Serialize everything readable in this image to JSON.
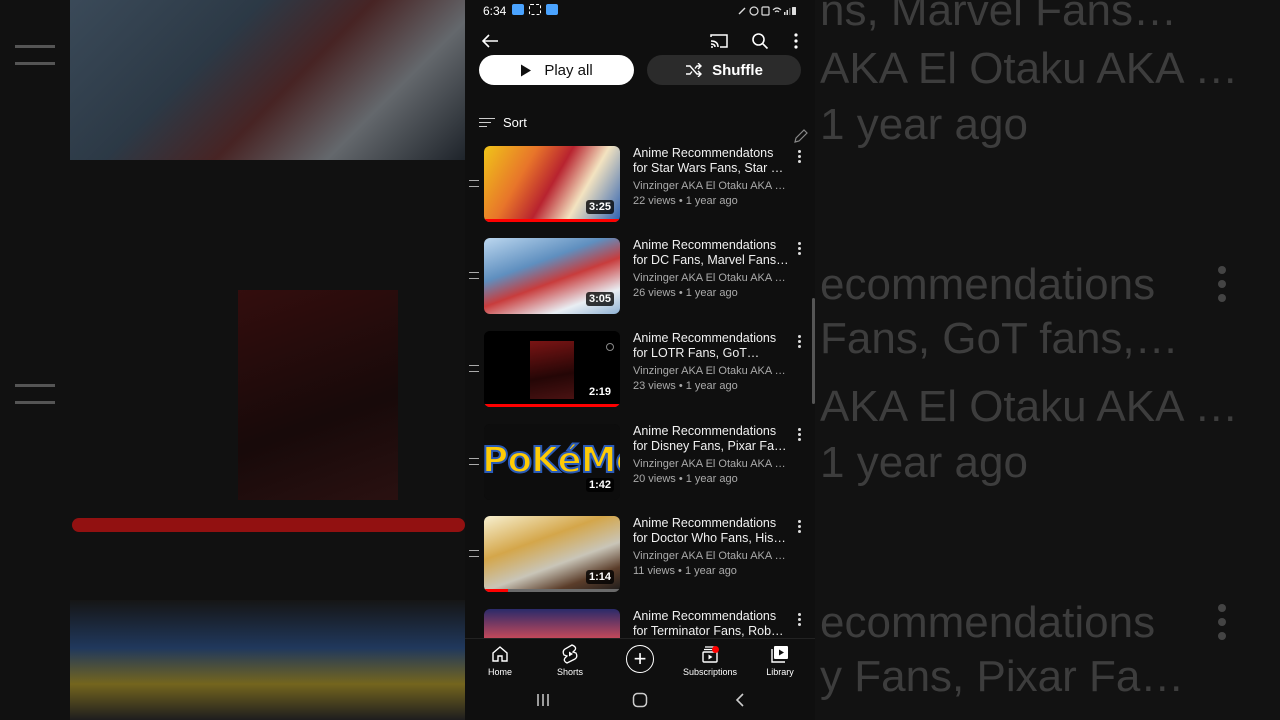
{
  "status_bar": {
    "time": "6:34"
  },
  "app_bar": {
    "back_icon": "arrow-left-icon",
    "cast_icon": "cast-icon",
    "search_icon": "search-icon",
    "more_icon": "more-vert-icon"
  },
  "actions": {
    "play_all": "Play all",
    "shuffle": "Shuffle"
  },
  "sort": {
    "label": "Sort"
  },
  "videos": [
    {
      "title": "Anime Recommendatons for Star Wars Fans, Star …",
      "channel": "Vinzinger AKA El Otaku AKA …",
      "stats": "22 views • 1 year ago",
      "duration": "3:25",
      "watched": 1.0
    },
    {
      "title": "Anime Recommendations for DC Fans, Marvel Fans…",
      "channel": "Vinzinger AKA El Otaku AKA …",
      "stats": "26 views • 1 year ago",
      "duration": "3:05",
      "watched": 0
    },
    {
      "title": "Anime Recommendations for LOTR Fans, GoT fans,…",
      "channel": "Vinzinger AKA El Otaku AKA …",
      "stats": "23 views • 1 year ago",
      "duration": "2:19",
      "watched": 1.0
    },
    {
      "title": "Anime Recommendations for Disney Fans, Pixar Fa…",
      "channel": "Vinzinger AKA El Otaku AKA …",
      "stats": "20 views • 1 year ago",
      "duration": "1:42",
      "watched": 0,
      "thumb_text": "PoKéMoN"
    },
    {
      "title": "Anime Recommendations for Doctor Who Fans, His…",
      "channel": "Vinzinger AKA El Otaku AKA …",
      "stats": "11 views • 1 year ago",
      "duration": "1:14",
      "watched": 0.18
    },
    {
      "title": "Anime Recommendations for Terminator Fans, Rob…",
      "channel": "",
      "stats": "",
      "duration": "",
      "watched": 0
    }
  ],
  "bottom_nav": {
    "home": "Home",
    "shorts": "Shorts",
    "subscriptions": "Subscriptions",
    "library": "Library"
  },
  "background": {
    "right_lines": [
      "ns, Marvel Fans…",
      "AKA El Otaku AKA …",
      "1 year ago",
      "ecommendations",
      "Fans, GoT fans,…",
      "AKA El Otaku AKA …",
      "1 year ago",
      "ecommendations",
      "y Fans, Pixar Fa…"
    ]
  },
  "colors": {
    "accent": "#ff0000",
    "surface": "#0f0f0f",
    "text_secondary": "#aaaaaa"
  }
}
